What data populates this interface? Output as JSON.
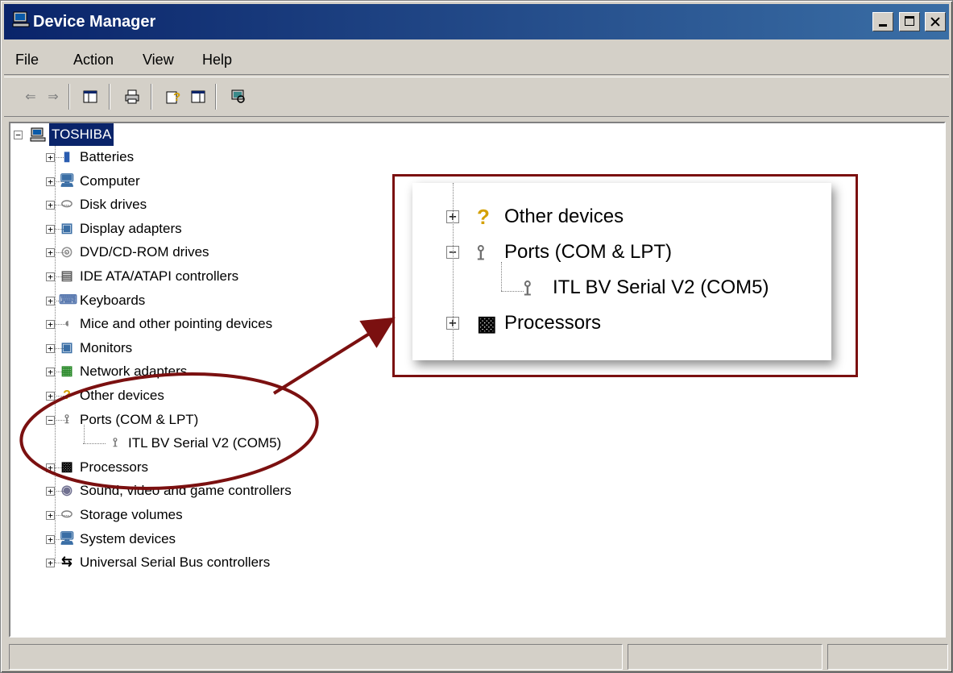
{
  "window": {
    "title": "Device Manager",
    "title_icon": "computer-icon"
  },
  "menu": {
    "items": [
      {
        "label": "File"
      },
      {
        "label": "Action"
      },
      {
        "label": "View"
      },
      {
        "label": "Help"
      }
    ]
  },
  "toolbar": {
    "buttons": [
      "back-arrow-icon",
      "forward-arrow-icon",
      "show-hide-console-tree-icon",
      "print-icon",
      "help-icon",
      "properties-icon",
      "scan-hardware-icon"
    ]
  },
  "tree": {
    "root": {
      "label": "TOSHIBA",
      "icon": "computer-icon"
    },
    "items": [
      {
        "label": "Batteries",
        "icon": "battery-icon",
        "expander": "+"
      },
      {
        "label": "Computer",
        "icon": "computer-icon",
        "expander": "+"
      },
      {
        "label": "Disk drives",
        "icon": "disk-drive-icon",
        "expander": "+"
      },
      {
        "label": "Display adapters",
        "icon": "monitor-icon",
        "expander": "+"
      },
      {
        "label": "DVD/CD-ROM drives",
        "icon": "cd-icon",
        "expander": "+"
      },
      {
        "label": "IDE ATA/ATAPI controllers",
        "icon": "ide-controller-icon",
        "expander": "+"
      },
      {
        "label": "Keyboards",
        "icon": "keyboard-icon",
        "expander": "+"
      },
      {
        "label": "Mice and other pointing devices",
        "icon": "mouse-icon",
        "expander": "+"
      },
      {
        "label": "Monitors",
        "icon": "monitor-icon",
        "expander": "+"
      },
      {
        "label": "Network adapters",
        "icon": "network-card-icon",
        "expander": "+"
      },
      {
        "label": "Other devices",
        "icon": "question-icon",
        "expander": "+"
      },
      {
        "label": "Ports (COM & LPT)",
        "icon": "port-icon",
        "expander": "−"
      },
      {
        "label": "ITL BV Serial V2 (COM5)",
        "icon": "port-icon",
        "expander": "",
        "child": true
      },
      {
        "label": "Processors",
        "icon": "chip-icon",
        "expander": "+"
      },
      {
        "label": "Sound, video and game controllers",
        "icon": "speaker-icon",
        "expander": "+"
      },
      {
        "label": "Storage volumes",
        "icon": "disk-drive-icon",
        "expander": "+"
      },
      {
        "label": "System devices",
        "icon": "computer-icon",
        "expander": "+"
      },
      {
        "label": "Universal Serial Bus controllers",
        "icon": "usb-icon",
        "expander": "+"
      }
    ]
  },
  "zoom": {
    "items": [
      {
        "label": "Other devices",
        "expander": "+"
      },
      {
        "label": "Ports (COM & LPT)",
        "expander": "−"
      },
      {
        "label": "ITL BV Serial V2 (COM5)",
        "expander": ""
      },
      {
        "label": "Processors",
        "expander": "+"
      }
    ]
  },
  "colors": {
    "title_gradient_start": "#0a246a",
    "title_gradient_end": "#3a6ea5",
    "annotation": "#7b1010",
    "selection": "#0a246a"
  }
}
